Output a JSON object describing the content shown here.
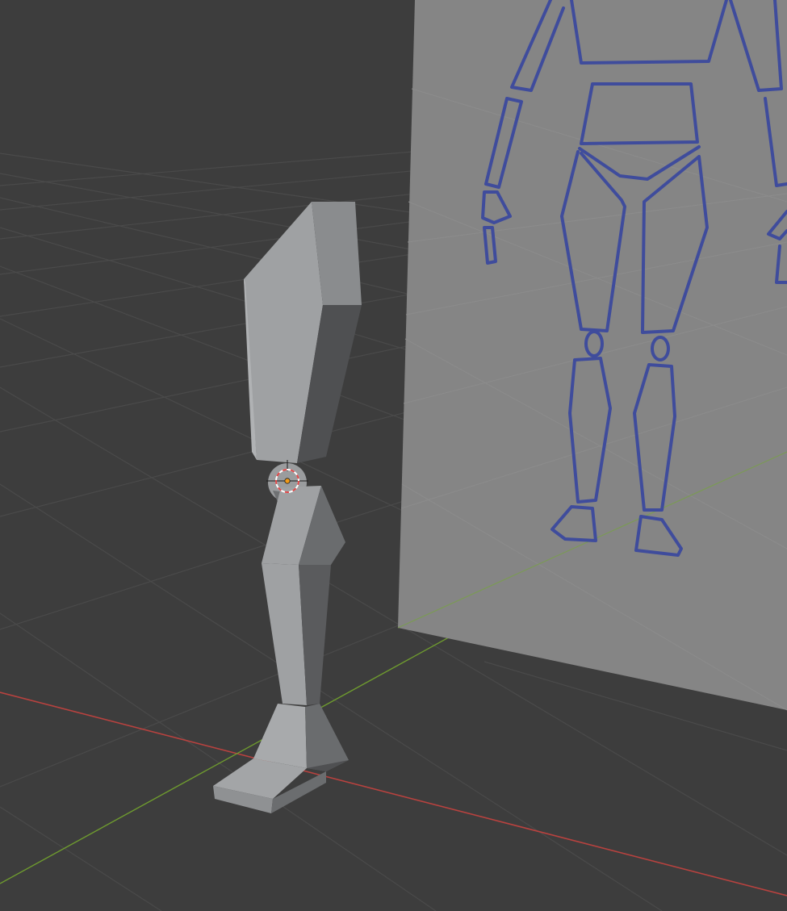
{
  "viewport": {
    "background_color": "#3d3d3d",
    "grid_line_color": "#4a4a4a",
    "x_axis_color": "#b8423f",
    "y_axis_color": "#6e9a2f"
  },
  "reference_plane": {
    "fill_color": "#858585",
    "sketch_color": "#3f4c9c"
  },
  "model": {
    "shading_light": "#9fa1a3",
    "shading_mid": "#8a8c8e",
    "shading_dark": "#4f5052",
    "shading_darkest": "#3b3c3e"
  },
  "cursor_3d": {
    "ring_color_a": "#e04848",
    "ring_color_b": "#ffffff",
    "origin_color": "#f09a1a",
    "icon": "3d-cursor-icon"
  }
}
